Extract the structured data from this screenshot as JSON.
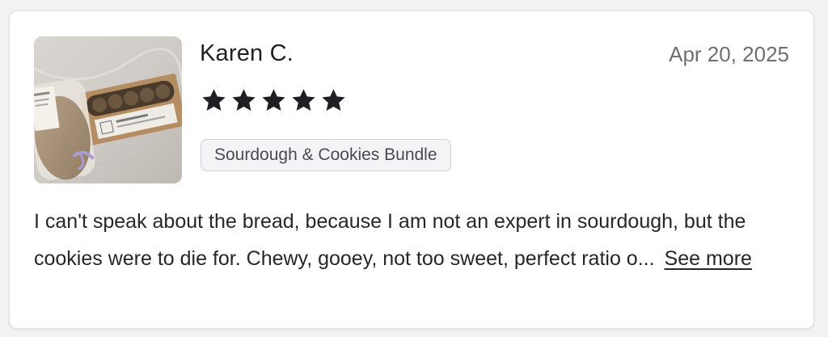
{
  "review": {
    "reviewer_name": "Karen C.",
    "date": "Apr 20, 2025",
    "rating": 5,
    "rating_max": 5,
    "product_tag": "Sourdough & Cookies Bundle",
    "text_truncated": "I can't speak about the bread, because I am not an expert in sourdough, but the cookies were to die for.  Chewy, gooey, not too sweet, perfect ratio o...",
    "see_more_label": "See more",
    "photo_icon": "review-photo-thumbnail"
  },
  "colors": {
    "star": "#1f1f24",
    "date_text": "#6e6e76",
    "tag_border": "#d0d0d6",
    "tag_bg": "#f4f4f6"
  }
}
